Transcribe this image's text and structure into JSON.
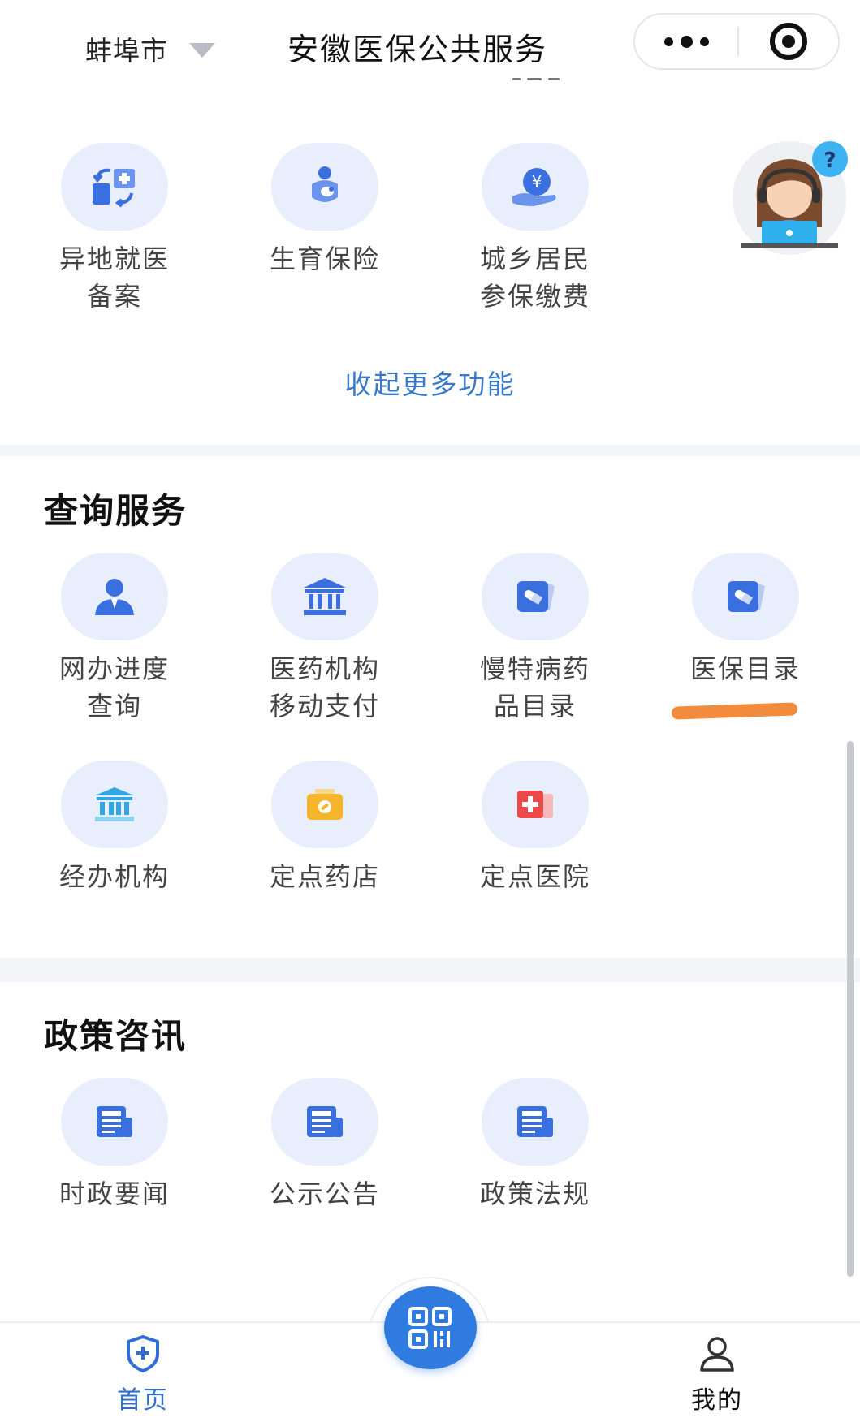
{
  "navbar": {
    "city": "蚌埠市",
    "title": "安徽医保公共服务"
  },
  "top_services": [
    {
      "label": "异地就医\n备案",
      "icon": "transfer-medical-icon"
    },
    {
      "label": "生育保险",
      "icon": "maternity-icon"
    },
    {
      "label": "城乡居民\n参保缴费",
      "icon": "yuan-hand-icon"
    }
  ],
  "collapse_label": "收起更多功能",
  "query_section": {
    "title": "查询服务",
    "items": [
      {
        "label": "网办进度\n查询",
        "icon": "person-icon"
      },
      {
        "label": "医药机构\n移动支付",
        "icon": "institution-icon"
      },
      {
        "label": "慢特病药\n品目录",
        "icon": "pill-icon"
      },
      {
        "label": "医保目录",
        "icon": "pill-icon"
      },
      {
        "label": "经办机构",
        "icon": "bank-icon"
      },
      {
        "label": "定点药店",
        "icon": "pharmacy-icon"
      },
      {
        "label": "定点医院",
        "icon": "hospital-icon"
      }
    ]
  },
  "policy_section": {
    "title": "政策咨讯",
    "items": [
      {
        "label": "时政要闻",
        "icon": "news-icon"
      },
      {
        "label": "公示公告",
        "icon": "news-icon"
      },
      {
        "label": "政策法规",
        "icon": "news-icon"
      }
    ]
  },
  "tabbar": {
    "home": "首页",
    "mine": "我的"
  },
  "colors": {
    "accent": "#2f7be0",
    "icon_blue": "#3a6fe0",
    "icon_circle": "#e8eefc",
    "highlight_mark": "#f28b3c"
  }
}
